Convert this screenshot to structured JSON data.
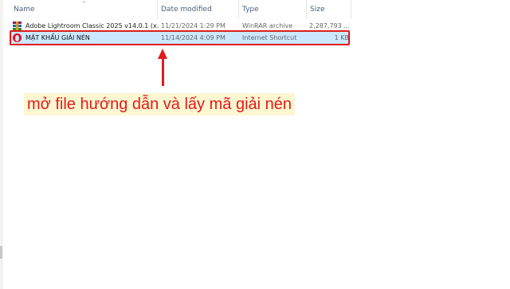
{
  "columns": {
    "name": "Name",
    "date_modified": "Date modified",
    "type": "Type",
    "size": "Size"
  },
  "files": [
    {
      "name": "Adobe Lightroom Classic 2025 v14.0.1 (x...",
      "date": "11/21/2024 1:29 PM",
      "type": "WinRAR archive",
      "size": "2,287,793 ...",
      "icon": "winrar-archive-icon",
      "selected": false
    },
    {
      "name": "MẬT KHẨU GIẢI NÉN",
      "date": "11/14/2024 4:09 PM",
      "type": "Internet Shortcut",
      "size": "1 KB",
      "icon": "opera-shortcut-icon",
      "selected": true
    }
  ],
  "annotation": {
    "text": "mở file hướng dẫn và lấy mã giải nén",
    "color": "#e21b1b",
    "background": "#fdf7d2"
  },
  "colors": {
    "selected_row": "#cce8ff",
    "header_text": "#4c607a"
  }
}
